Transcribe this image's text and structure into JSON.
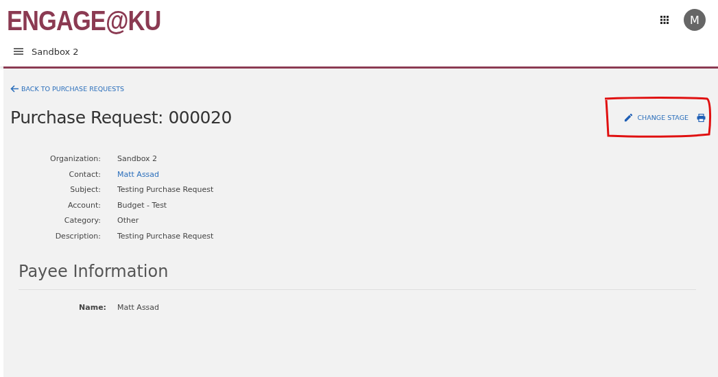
{
  "header": {
    "logo": "ENGAGE@KU",
    "avatar": "M",
    "org": "Sandbox 2"
  },
  "back_link": "BACK TO PURCHASE REQUESTS",
  "title": "Purchase Request: 000020",
  "actions": {
    "change_stage": "CHANGE STAGE"
  },
  "details": [
    {
      "label": "Organization:",
      "value": "Sandbox 2",
      "kind": "text"
    },
    {
      "label": "Contact:",
      "value": "Matt Assad",
      "kind": "link"
    },
    {
      "label": "Subject:",
      "value": "Testing Purchase Request",
      "kind": "text"
    },
    {
      "label": "Account:",
      "value": "Budget - Test",
      "kind": "text"
    },
    {
      "label": "Category:",
      "value": "Other",
      "kind": "text"
    },
    {
      "label": "Description:",
      "value": "Testing Purchase Request",
      "kind": "text"
    }
  ],
  "payee": {
    "heading": "Payee Information",
    "fields": [
      {
        "label": "Name:",
        "value": "Matt Assad"
      }
    ]
  }
}
